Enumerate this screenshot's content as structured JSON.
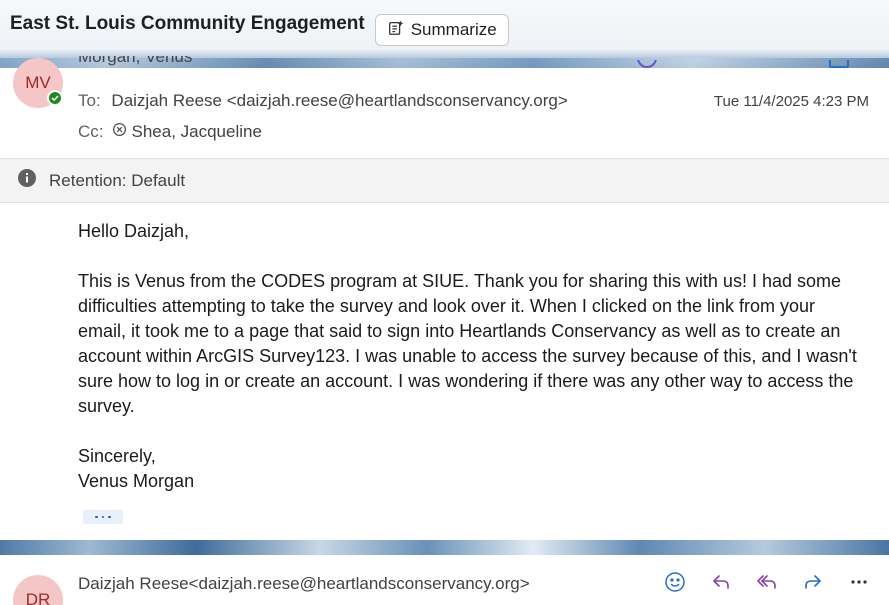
{
  "header": {
    "subject": "East St. Louis Community Engagement",
    "summarize_label": "Summarize"
  },
  "message1": {
    "avatar_initials": "MV",
    "sender": "Morgan, Venus",
    "to_label": "To:",
    "to_value": "Daizjah Reese <daizjah.reese@heartlandsconservancy.org>",
    "cc_label": "Cc:",
    "cc_value": "Shea, Jacqueline",
    "date": "Tue 11/4/2025 4:23 PM",
    "retention": "Retention: Default",
    "greeting": "Hello Daizjah,",
    "paragraph": "This is Venus from the CODES program at SIUE. Thank you for sharing this with us! I had some difficulties attempting to take the survey and look over it. When I clicked on the link from your email, it took me to a page that said to sign into Heartlands Conservancy as well as to create an account within ArcGIS Survey123. I was unable to access the survey because of this, and I wasn't sure how to log in or create an account. I was wondering if there was any other way to access the survey.",
    "closing": "Sincerely,",
    "signature": "Venus Morgan"
  },
  "message2": {
    "avatar_initials": "DR",
    "sender": "Daizjah Reese<daizjah.reese@heartlandsconservancy.org>",
    "actions": [
      "emoji-icon",
      "reply-icon",
      "reply-all-icon",
      "forward-icon",
      "more-icon"
    ]
  },
  "colors": {
    "avatar_bg": "#f4c6c6",
    "avatar_text": "#9a2a2a",
    "accent": "#6b3fa0",
    "forward": "#2b6cc4",
    "presence": "#1f8a1f"
  }
}
